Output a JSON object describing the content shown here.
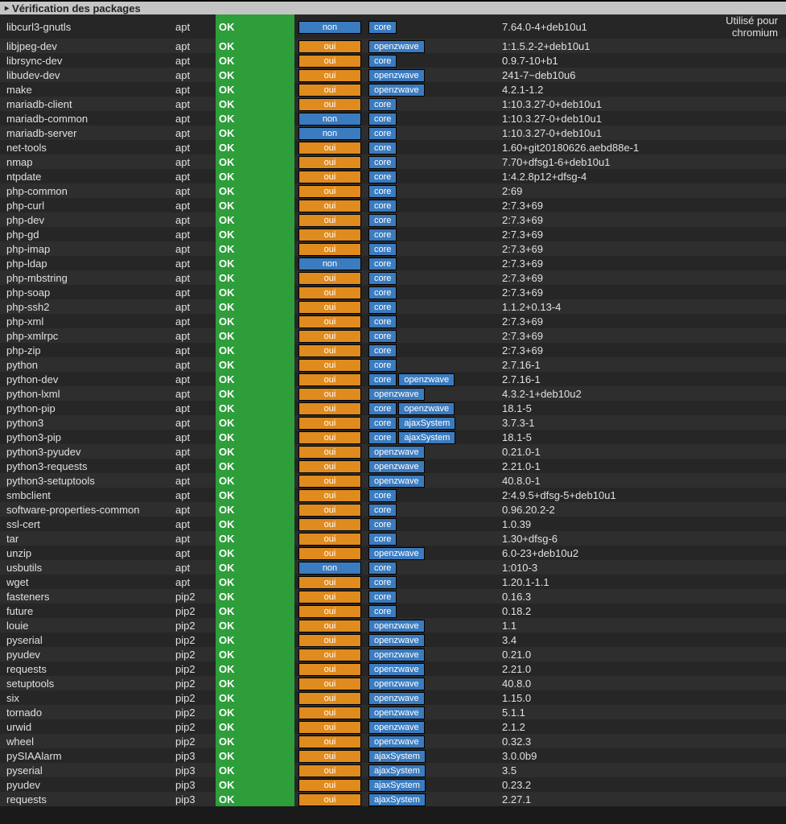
{
  "header": {
    "title": "Vérification des packages"
  },
  "labels": {
    "status_ok": "OK",
    "required_yes": "oui",
    "required_no": "non"
  },
  "tag_labels": {
    "core": "core",
    "openzwave": "openzwave",
    "ajaxSystem": "ajaxSystem"
  },
  "note_chromium": "Utilisé pour chromium",
  "rows": [
    {
      "name": "libcurl3-gnutls",
      "type": "apt",
      "status": "OK",
      "req": "non",
      "tags": [
        "core"
      ],
      "version": "7.64.0-4+deb10u1",
      "note": "Utilisé pour chromium"
    },
    {
      "name": "libjpeg-dev",
      "type": "apt",
      "status": "OK",
      "req": "oui",
      "tags": [
        "openzwave"
      ],
      "version": "1:1.5.2-2+deb10u1"
    },
    {
      "name": "librsync-dev",
      "type": "apt",
      "status": "OK",
      "req": "oui",
      "tags": [
        "core"
      ],
      "version": "0.9.7-10+b1"
    },
    {
      "name": "libudev-dev",
      "type": "apt",
      "status": "OK",
      "req": "oui",
      "tags": [
        "openzwave"
      ],
      "version": "241-7~deb10u6"
    },
    {
      "name": "make",
      "type": "apt",
      "status": "OK",
      "req": "oui",
      "tags": [
        "openzwave"
      ],
      "version": "4.2.1-1.2"
    },
    {
      "name": "mariadb-client",
      "type": "apt",
      "status": "OK",
      "req": "oui",
      "tags": [
        "core"
      ],
      "version": "1:10.3.27-0+deb10u1"
    },
    {
      "name": "mariadb-common",
      "type": "apt",
      "status": "OK",
      "req": "non",
      "tags": [
        "core"
      ],
      "version": "1:10.3.27-0+deb10u1"
    },
    {
      "name": "mariadb-server",
      "type": "apt",
      "status": "OK",
      "req": "non",
      "tags": [
        "core"
      ],
      "version": "1:10.3.27-0+deb10u1"
    },
    {
      "name": "net-tools",
      "type": "apt",
      "status": "OK",
      "req": "oui",
      "tags": [
        "core"
      ],
      "version": "1.60+git20180626.aebd88e-1"
    },
    {
      "name": "nmap",
      "type": "apt",
      "status": "OK",
      "req": "oui",
      "tags": [
        "core"
      ],
      "version": "7.70+dfsg1-6+deb10u1"
    },
    {
      "name": "ntpdate",
      "type": "apt",
      "status": "OK",
      "req": "oui",
      "tags": [
        "core"
      ],
      "version": "1:4.2.8p12+dfsg-4"
    },
    {
      "name": "php-common",
      "type": "apt",
      "status": "OK",
      "req": "oui",
      "tags": [
        "core"
      ],
      "version": "2:69"
    },
    {
      "name": "php-curl",
      "type": "apt",
      "status": "OK",
      "req": "oui",
      "tags": [
        "core"
      ],
      "version": "2:7.3+69"
    },
    {
      "name": "php-dev",
      "type": "apt",
      "status": "OK",
      "req": "oui",
      "tags": [
        "core"
      ],
      "version": "2:7.3+69"
    },
    {
      "name": "php-gd",
      "type": "apt",
      "status": "OK",
      "req": "oui",
      "tags": [
        "core"
      ],
      "version": "2:7.3+69"
    },
    {
      "name": "php-imap",
      "type": "apt",
      "status": "OK",
      "req": "oui",
      "tags": [
        "core"
      ],
      "version": "2:7.3+69"
    },
    {
      "name": "php-ldap",
      "type": "apt",
      "status": "OK",
      "req": "non",
      "tags": [
        "core"
      ],
      "version": "2:7.3+69"
    },
    {
      "name": "php-mbstring",
      "type": "apt",
      "status": "OK",
      "req": "oui",
      "tags": [
        "core"
      ],
      "version": "2:7.3+69"
    },
    {
      "name": "php-soap",
      "type": "apt",
      "status": "OK",
      "req": "oui",
      "tags": [
        "core"
      ],
      "version": "2:7.3+69"
    },
    {
      "name": "php-ssh2",
      "type": "apt",
      "status": "OK",
      "req": "oui",
      "tags": [
        "core"
      ],
      "version": "1.1.2+0.13-4"
    },
    {
      "name": "php-xml",
      "type": "apt",
      "status": "OK",
      "req": "oui",
      "tags": [
        "core"
      ],
      "version": "2:7.3+69"
    },
    {
      "name": "php-xmlrpc",
      "type": "apt",
      "status": "OK",
      "req": "oui",
      "tags": [
        "core"
      ],
      "version": "2:7.3+69"
    },
    {
      "name": "php-zip",
      "type": "apt",
      "status": "OK",
      "req": "oui",
      "tags": [
        "core"
      ],
      "version": "2:7.3+69"
    },
    {
      "name": "python",
      "type": "apt",
      "status": "OK",
      "req": "oui",
      "tags": [
        "core"
      ],
      "version": "2.7.16-1"
    },
    {
      "name": "python-dev",
      "type": "apt",
      "status": "OK",
      "req": "oui",
      "tags": [
        "core",
        "openzwave"
      ],
      "version": "2.7.16-1"
    },
    {
      "name": "python-lxml",
      "type": "apt",
      "status": "OK",
      "req": "oui",
      "tags": [
        "openzwave"
      ],
      "version": "4.3.2-1+deb10u2"
    },
    {
      "name": "python-pip",
      "type": "apt",
      "status": "OK",
      "req": "oui",
      "tags": [
        "core",
        "openzwave"
      ],
      "version": "18.1-5"
    },
    {
      "name": "python3",
      "type": "apt",
      "status": "OK",
      "req": "oui",
      "tags": [
        "core",
        "ajaxSystem"
      ],
      "version": "3.7.3-1"
    },
    {
      "name": "python3-pip",
      "type": "apt",
      "status": "OK",
      "req": "oui",
      "tags": [
        "core",
        "ajaxSystem"
      ],
      "version": "18.1-5"
    },
    {
      "name": "python3-pyudev",
      "type": "apt",
      "status": "OK",
      "req": "oui",
      "tags": [
        "openzwave"
      ],
      "version": "0.21.0-1"
    },
    {
      "name": "python3-requests",
      "type": "apt",
      "status": "OK",
      "req": "oui",
      "tags": [
        "openzwave"
      ],
      "version": "2.21.0-1"
    },
    {
      "name": "python3-setuptools",
      "type": "apt",
      "status": "OK",
      "req": "oui",
      "tags": [
        "openzwave"
      ],
      "version": "40.8.0-1"
    },
    {
      "name": "smbclient",
      "type": "apt",
      "status": "OK",
      "req": "oui",
      "tags": [
        "core"
      ],
      "version": "2:4.9.5+dfsg-5+deb10u1"
    },
    {
      "name": "software-properties-common",
      "type": "apt",
      "status": "OK",
      "req": "oui",
      "tags": [
        "core"
      ],
      "version": "0.96.20.2-2"
    },
    {
      "name": "ssl-cert",
      "type": "apt",
      "status": "OK",
      "req": "oui",
      "tags": [
        "core"
      ],
      "version": "1.0.39"
    },
    {
      "name": "tar",
      "type": "apt",
      "status": "OK",
      "req": "oui",
      "tags": [
        "core"
      ],
      "version": "1.30+dfsg-6"
    },
    {
      "name": "unzip",
      "type": "apt",
      "status": "OK",
      "req": "oui",
      "tags": [
        "openzwave"
      ],
      "version": "6.0-23+deb10u2"
    },
    {
      "name": "usbutils",
      "type": "apt",
      "status": "OK",
      "req": "non",
      "tags": [
        "core"
      ],
      "version": "1:010-3"
    },
    {
      "name": "wget",
      "type": "apt",
      "status": "OK",
      "req": "oui",
      "tags": [
        "core"
      ],
      "version": "1.20.1-1.1"
    },
    {
      "name": "fasteners",
      "type": "pip2",
      "status": "OK",
      "req": "oui",
      "tags": [
        "core"
      ],
      "version": "0.16.3"
    },
    {
      "name": "future",
      "type": "pip2",
      "status": "OK",
      "req": "oui",
      "tags": [
        "core"
      ],
      "version": "0.18.2"
    },
    {
      "name": "louie",
      "type": "pip2",
      "status": "OK",
      "req": "oui",
      "tags": [
        "openzwave"
      ],
      "version": "1.1"
    },
    {
      "name": "pyserial",
      "type": "pip2",
      "status": "OK",
      "req": "oui",
      "tags": [
        "openzwave"
      ],
      "version": "3.4"
    },
    {
      "name": "pyudev",
      "type": "pip2",
      "status": "OK",
      "req": "oui",
      "tags": [
        "openzwave"
      ],
      "version": "0.21.0"
    },
    {
      "name": "requests",
      "type": "pip2",
      "status": "OK",
      "req": "oui",
      "tags": [
        "openzwave"
      ],
      "version": "2.21.0"
    },
    {
      "name": "setuptools",
      "type": "pip2",
      "status": "OK",
      "req": "oui",
      "tags": [
        "openzwave"
      ],
      "version": "40.8.0"
    },
    {
      "name": "six",
      "type": "pip2",
      "status": "OK",
      "req": "oui",
      "tags": [
        "openzwave"
      ],
      "version": "1.15.0"
    },
    {
      "name": "tornado",
      "type": "pip2",
      "status": "OK",
      "req": "oui",
      "tags": [
        "openzwave"
      ],
      "version": "5.1.1"
    },
    {
      "name": "urwid",
      "type": "pip2",
      "status": "OK",
      "req": "oui",
      "tags": [
        "openzwave"
      ],
      "version": "2.1.2"
    },
    {
      "name": "wheel",
      "type": "pip2",
      "status": "OK",
      "req": "oui",
      "tags": [
        "openzwave"
      ],
      "version": "0.32.3"
    },
    {
      "name": "pySIAAlarm",
      "type": "pip3",
      "status": "OK",
      "req": "oui",
      "tags": [
        "ajaxSystem"
      ],
      "version": "3.0.0b9"
    },
    {
      "name": "pyserial",
      "type": "pip3",
      "status": "OK",
      "req": "oui",
      "tags": [
        "ajaxSystem"
      ],
      "version": "3.5"
    },
    {
      "name": "pyudev",
      "type": "pip3",
      "status": "OK",
      "req": "oui",
      "tags": [
        "ajaxSystem"
      ],
      "version": "0.23.2"
    },
    {
      "name": "requests",
      "type": "pip3",
      "status": "OK",
      "req": "oui",
      "tags": [
        "ajaxSystem"
      ],
      "version": "2.27.1"
    }
  ]
}
